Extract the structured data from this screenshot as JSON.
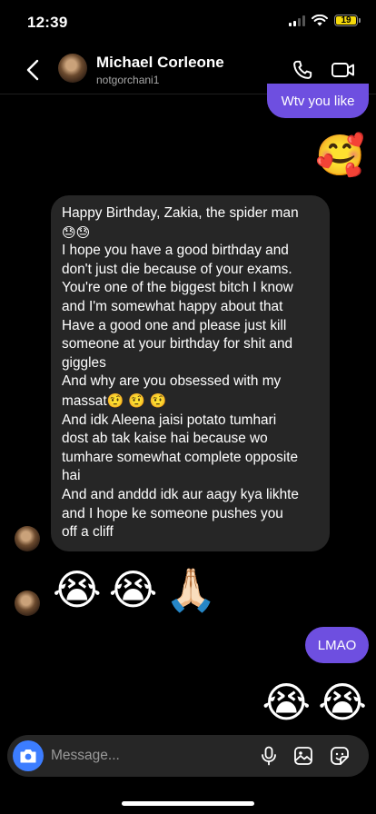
{
  "status_bar": {
    "time": "12:39",
    "battery_level": "19",
    "battery_color": "#f5d90a"
  },
  "header": {
    "name": "Michael Corleone",
    "handle": "notgorchani1",
    "back_icon": "chevron-left-icon",
    "call_icon": "phone-icon",
    "video_icon": "video-camera-icon"
  },
  "messages": {
    "sent_1": "Wtv you like",
    "sent_reaction": "🥰",
    "received_text": {
      "line_1": "Happy Birthday, Zakia, the spider man",
      "line_1_emoji": "😓😓",
      "line_2": "I hope you have a good birthday and",
      "line_3": "don't just die because of your exams.",
      "line_4": "You're one of the biggest bitch I know",
      "line_5": "and I'm somewhat happy about that",
      "line_6": "Have a good one and please just kill",
      "line_7": "someone at your birthday for shit and",
      "line_8": "giggles",
      "line_9": "And why are you obsessed with my",
      "line_10": "massat",
      "line_10_emoji": "🤨 🤨 🤨",
      "line_11": "And idk Aleena jaisi potato tumhari",
      "line_12": "dost ab tak kaise hai because wo",
      "line_13": "tumhare somewhat complete opposite",
      "line_14": "hai",
      "line_15": "And and anddd idk aur aagy kya likhte",
      "line_16": "and I hope ke someone pushes you",
      "line_17": "off a cliff"
    },
    "received_emojis": [
      "😭",
      "😭",
      "🙏🏻"
    ],
    "sent_2": "LMAO",
    "sent_emojis": [
      "😭",
      "😭"
    ]
  },
  "composer": {
    "placeholder": "Message..."
  },
  "colors": {
    "sent_bubble": "#6e4fe0",
    "received_bubble": "#262626",
    "camera_button": "#3c7dff"
  }
}
